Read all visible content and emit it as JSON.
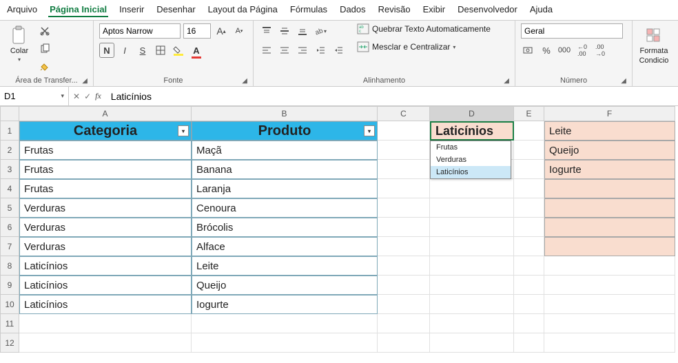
{
  "menu": [
    "Arquivo",
    "Página Inicial",
    "Inserir",
    "Desenhar",
    "Layout da Página",
    "Fórmulas",
    "Dados",
    "Revisão",
    "Exibir",
    "Desenvolvedor",
    "Ajuda"
  ],
  "menu_active": 1,
  "ribbon": {
    "clipboard": {
      "paste": "Colar",
      "label": "Área de Transfer..."
    },
    "font": {
      "name": "Aptos Narrow",
      "size": "16",
      "label": "Fonte"
    },
    "alignment": {
      "wrap": "Quebrar Texto Automaticamente",
      "merge": "Mesclar e Centralizar",
      "label": "Alinhamento"
    },
    "number": {
      "format": "Geral",
      "label": "Número"
    },
    "cond": {
      "line1": "Formata",
      "line2": "Condicio"
    }
  },
  "namebox": "D1",
  "formula": "Laticínios",
  "columns": [
    "A",
    "B",
    "C",
    "D",
    "E",
    "F"
  ],
  "rows": [
    1,
    2,
    3,
    4,
    5,
    6,
    7,
    8,
    9,
    10,
    11,
    12
  ],
  "table": {
    "headers": [
      "Categoria",
      "Produto"
    ],
    "data": [
      [
        "Frutas",
        "Maçã"
      ],
      [
        "Frutas",
        "Banana"
      ],
      [
        "Frutas",
        "Laranja"
      ],
      [
        "Verduras",
        "Cenoura"
      ],
      [
        "Verduras",
        "Brócolis"
      ],
      [
        "Verduras",
        "Alface"
      ],
      [
        "Laticínios",
        "Leite"
      ],
      [
        "Laticínios",
        "Queijo"
      ],
      [
        "Laticínios",
        "Iogurte"
      ]
    ]
  },
  "d1_value": "Laticínios",
  "d1_options": [
    "Frutas",
    "Verduras",
    "Laticínios"
  ],
  "d1_highlight": 2,
  "f_values": [
    "Leite",
    "Queijo",
    "Iogurte",
    "",
    "",
    "",
    ""
  ]
}
